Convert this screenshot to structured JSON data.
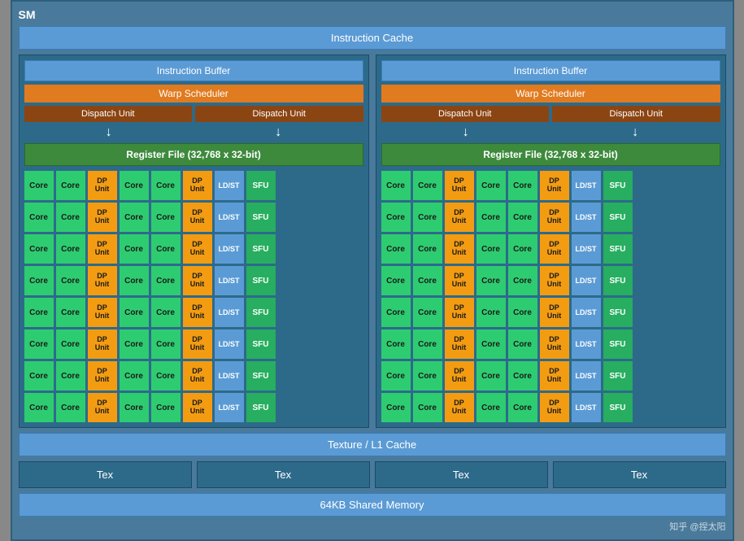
{
  "title": "SM",
  "instruction_cache": "Instruction Cache",
  "halves": [
    {
      "inst_buffer": "Instruction Buffer",
      "warp_scheduler": "Warp Scheduler",
      "dispatch_units": [
        "Dispatch Unit",
        "Dispatch Unit"
      ],
      "register_file": "Register File (32,768 x 32-bit)",
      "rows": 8
    },
    {
      "inst_buffer": "Instruction Buffer",
      "warp_scheduler": "Warp Scheduler",
      "dispatch_units": [
        "Dispatch Unit",
        "Dispatch Unit"
      ],
      "register_file": "Register File (32,768 x 32-bit)",
      "rows": 8
    }
  ],
  "core_label": "Core",
  "dp_label": "DP\nUnit",
  "ldst_label": "LD/ST",
  "sfu_label": "SFU",
  "texture_cache": "Texture / L1 Cache",
  "tex_units": [
    "Tex",
    "Tex",
    "Tex",
    "Tex"
  ],
  "shared_memory": "64KB Shared Memory",
  "watermark": "知乎 @捏太阳"
}
